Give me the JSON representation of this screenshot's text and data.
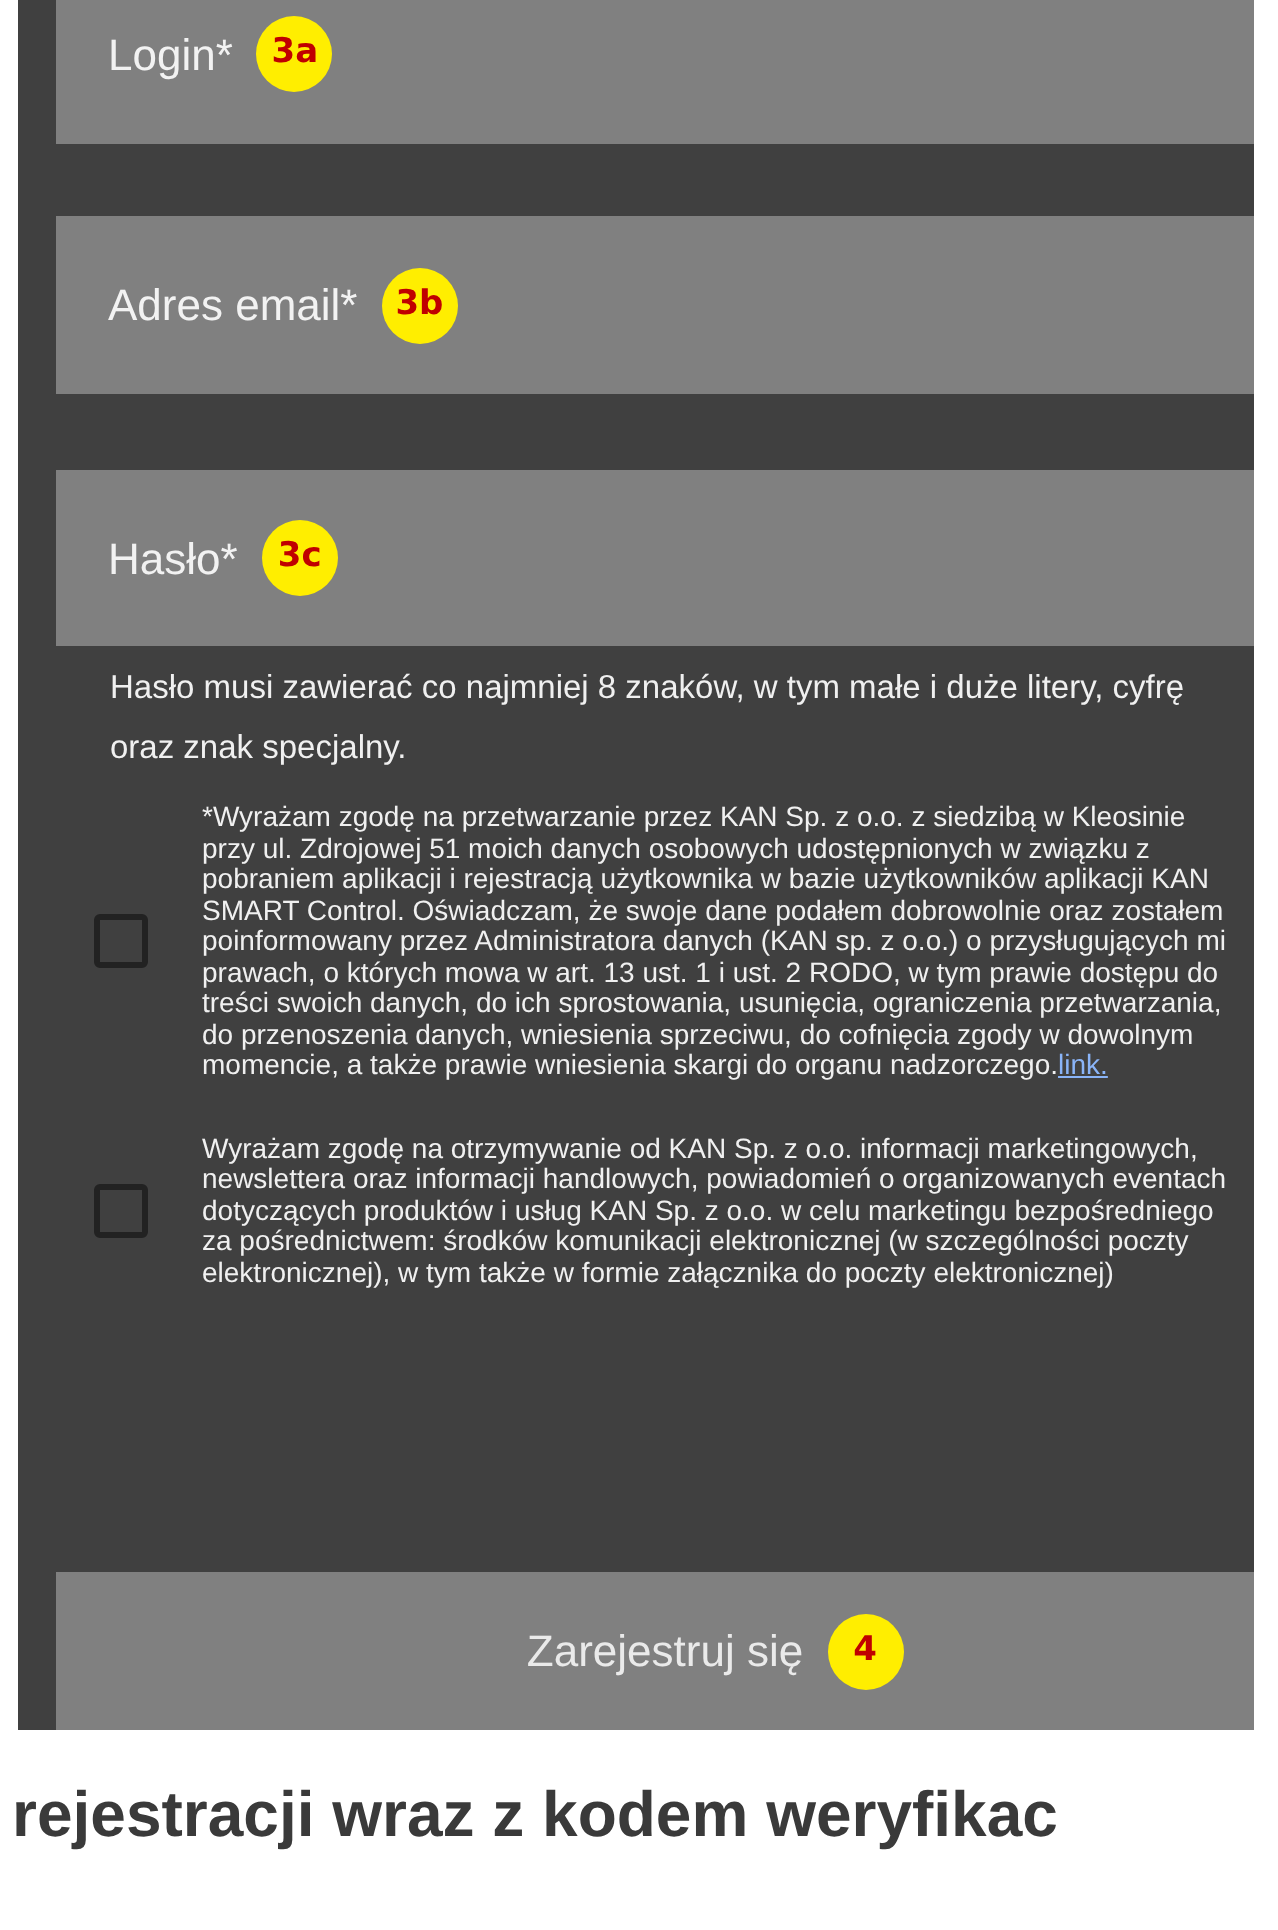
{
  "fields": [
    {
      "label": "Login*",
      "badge": "3a"
    },
    {
      "label": "Adres email*",
      "badge": "3b"
    },
    {
      "label": "Hasło*",
      "badge": "3c"
    }
  ],
  "password_hint": "Hasło musi zawierać co najmniej 8 znaków, w tym małe i duże litery, cyfrę oraz znak specjalny.",
  "consents": [
    {
      "text": "*Wyrażam zgodę na przetwarzanie przez KAN Sp. z o.o. z siedzibą w Kleosinie przy ul. Zdrojowej 51 moich danych osobowych udostępnionych w związku z pobraniem aplikacji i rejestracją użytkownika w bazie użytkowników aplikacji KAN SMART Control. Oświadczam, że swoje dane podałem dobrowolnie oraz zostałem poinformowany przez Administratora danych (KAN sp. z o.o.) o przysługujących mi prawach, o których mowa w art. 13 ust. 1 i ust. 2 RODO, w tym prawie dostępu do treści swoich danych, do ich sprostowania, usunięcia, ograniczenia przetwarzania, do przenoszenia danych, wniesienia sprzeciwu, do cofnięcia zgody w dowolnym momencie, a także prawie wniesienia skargi do organu nadzorczego.",
      "link": "link.",
      "checked": false
    },
    {
      "text": "Wyrażam zgodę na otrzymywanie od KAN Sp. z o.o. informacji marketingowych, newslettera oraz informacji handlowych, powiadomień o organizowanych eventach dotyczących produktów i usług KAN Sp. z o.o. w celu marketingu bezpośredniego za pośrednictwem: środków komunikacji elektronicznej (w szczególności poczty elektronicznej), w tym także w formie załącznika do poczty elektronicznej)",
      "checked": false
    }
  ],
  "submit": {
    "label": "Zarejestruj się",
    "badge": "4"
  },
  "caption": "rejestracji wraz z kodem weryfikac"
}
